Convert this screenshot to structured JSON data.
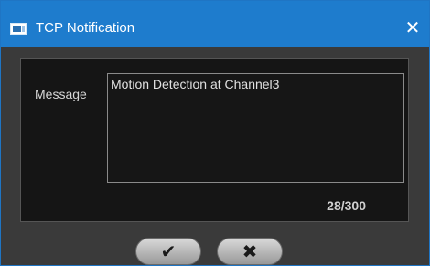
{
  "window": {
    "title": "TCP Notification",
    "close_glyph": "✕"
  },
  "form": {
    "message_label": "Message",
    "message_value": "Motion Detection at Channel3",
    "char_counter": "28/300"
  },
  "buttons": {
    "ok_glyph": "✔",
    "cancel_glyph": "✖"
  },
  "icons": {
    "app": "window-icon",
    "close": "close-icon",
    "ok": "checkmark-icon",
    "cancel": "x-icon"
  },
  "colors": {
    "titlebar": "#1e7ccd",
    "window_bg": "#3a3a3a",
    "panel_bg": "#151515"
  }
}
